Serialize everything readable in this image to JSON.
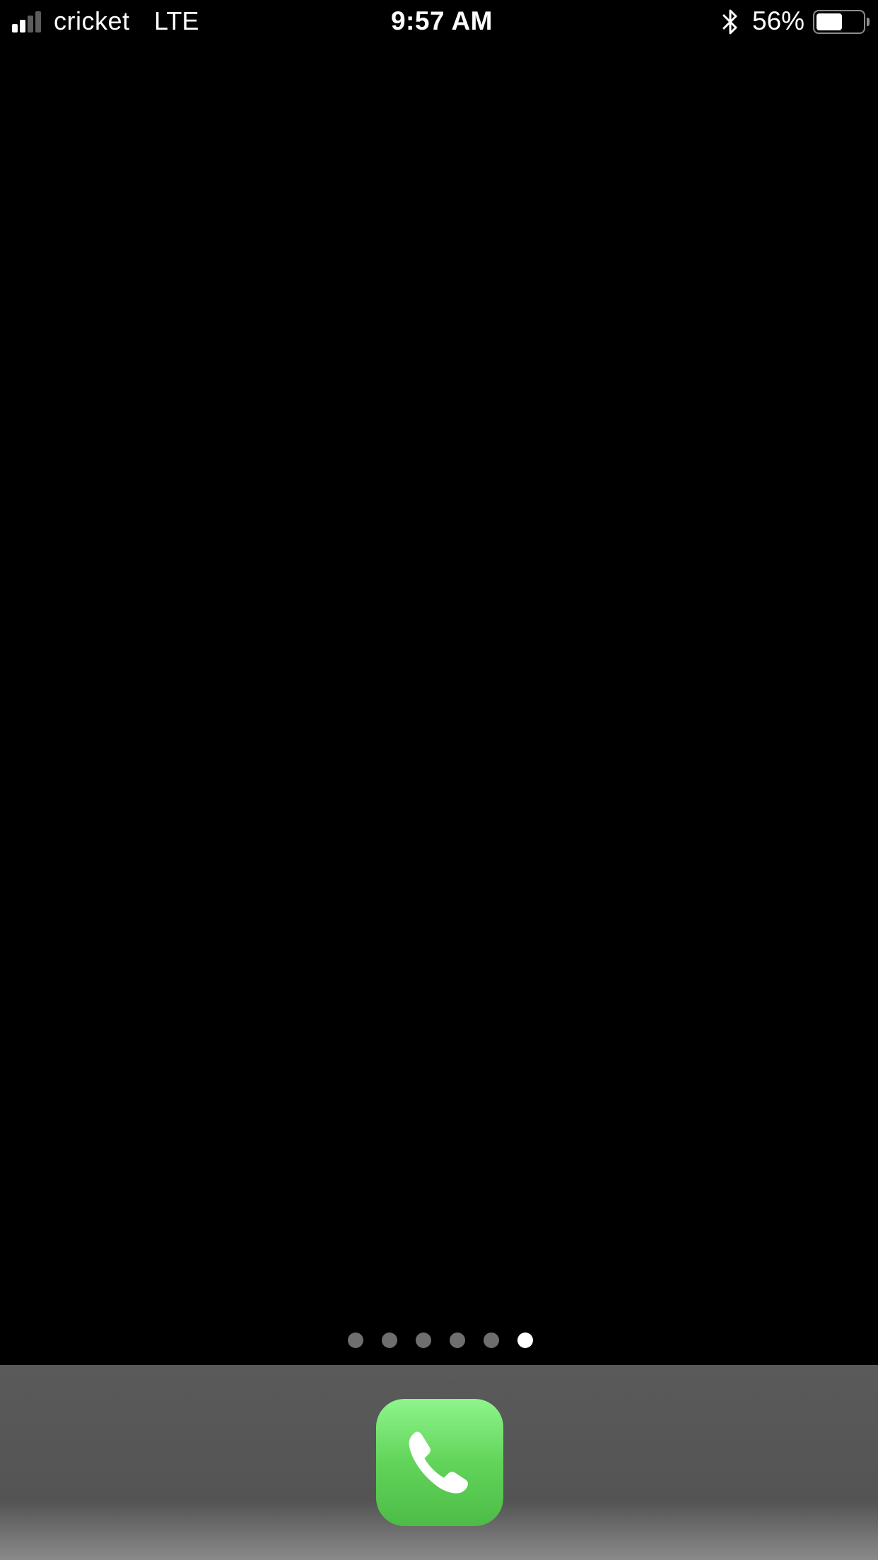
{
  "status_bar": {
    "signal_bars_filled": 2,
    "signal_bars_total": 4,
    "carrier": "cricket",
    "network": "LTE",
    "time": "9:57 AM",
    "bluetooth_icon": "bluetooth-icon",
    "battery_percent_label": "56%",
    "battery_level": 0.56
  },
  "home": {
    "page_count": 6,
    "current_page": 6
  },
  "dock": {
    "apps": [
      {
        "icon": "phone-icon"
      }
    ]
  },
  "colors": {
    "background": "#000000",
    "text": "#ffffff",
    "signal_inactive": "#5c5c5c",
    "dot_inactive": "#6e6e6e",
    "dot_active": "#ffffff",
    "phone_green": "#5fd35a"
  }
}
